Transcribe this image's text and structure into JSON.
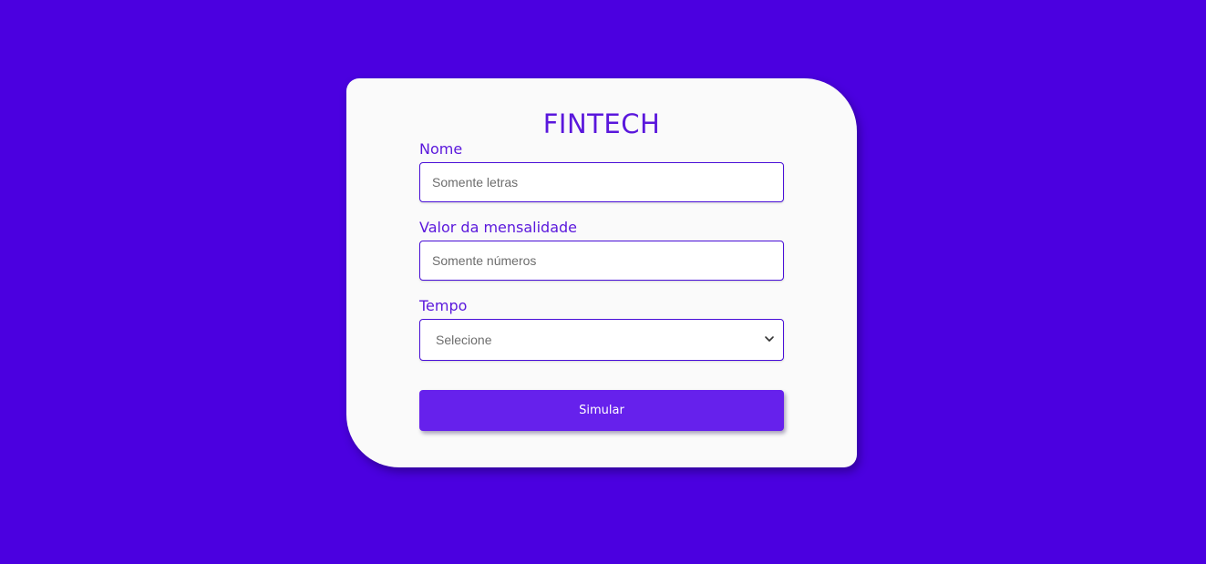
{
  "app": {
    "title": "FINTECH"
  },
  "form": {
    "name": {
      "label": "Nome",
      "placeholder": "Somente letras",
      "value": ""
    },
    "monthly": {
      "label": "Valor da mensalidade",
      "placeholder": "Somente números",
      "value": ""
    },
    "time": {
      "label": "Tempo",
      "selected": "Selecione",
      "icon": "chevron-down-icon"
    },
    "submit_label": "Simular"
  },
  "colors": {
    "background": "#4b00e0",
    "card": "#fafafa",
    "accent_text": "#5a17dc",
    "button": "#6621ec",
    "field_border": "#4a10d8"
  }
}
